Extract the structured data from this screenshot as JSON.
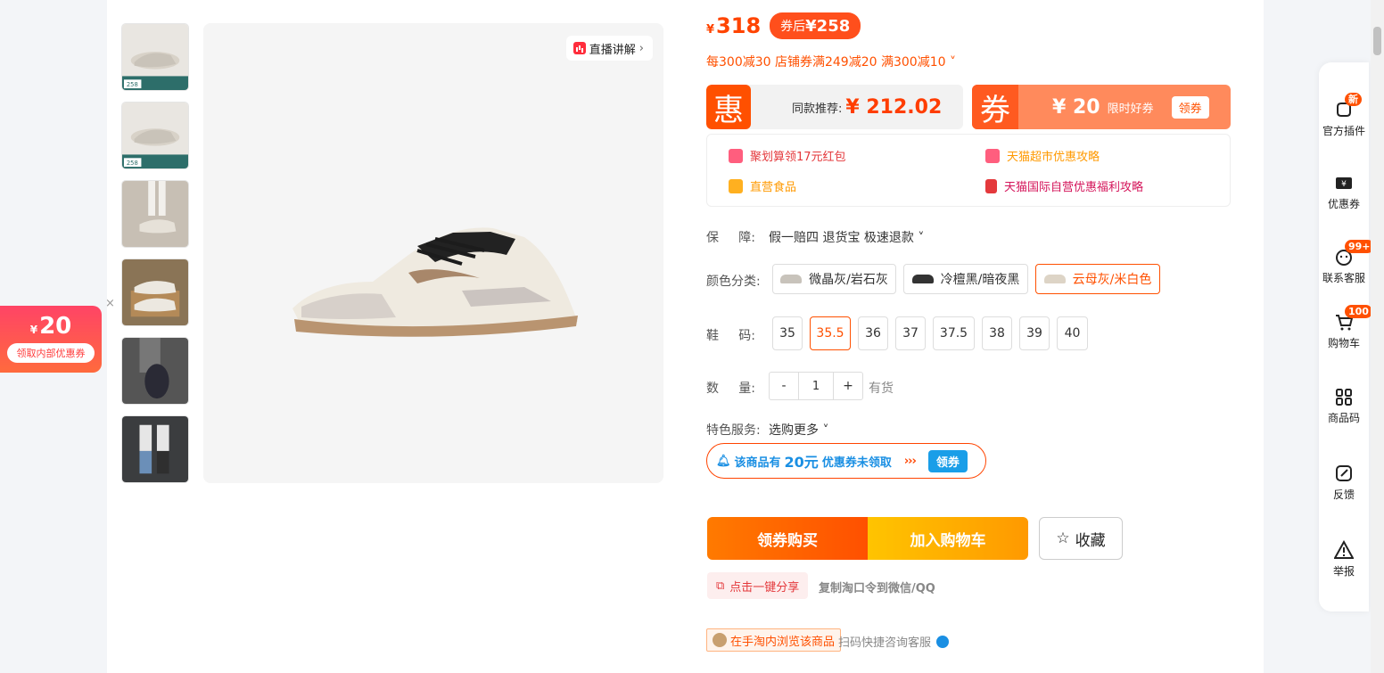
{
  "product": {
    "live_label": "直播讲解",
    "price_symbol": "¥",
    "price": "318",
    "coupon_price_prefix": "券后",
    "coupon_price": "¥258",
    "promotions": "每300减30 店铺券满249减20 满300减10"
  },
  "deals": {
    "hui_tag": "惠",
    "hui_text": "同款推荐:",
    "hui_price": "¥ 212.02",
    "quan_tag": "券",
    "quan_amount": "¥ 20",
    "quan_text": "限时好券",
    "quan_button": "领券"
  },
  "links": [
    {
      "label": "聚划算领17元红包",
      "color": "#e4393c"
    },
    {
      "label": "天猫超市优惠攻略",
      "color": "#ff9900"
    },
    {
      "label": "直营食品",
      "color": "#ff9900"
    },
    {
      "label": "天猫国际自营优惠福利攻略",
      "color": "#d4145a"
    }
  ],
  "guarantee": {
    "label": "保     障:",
    "value": "假一赔四 退货宝 极速退款"
  },
  "colors": {
    "label": "颜色分类:",
    "options": [
      "微晶灰/岩石灰",
      "冷檀黑/暗夜黑",
      "云母灰/米白色"
    ],
    "selected": 2
  },
  "sizes": {
    "label": "鞋     码:",
    "options": [
      "35",
      "35.5",
      "36",
      "37",
      "37.5",
      "38",
      "39",
      "40"
    ],
    "selected": 1
  },
  "quantity": {
    "label": "数     量:",
    "minus": "-",
    "value": "1",
    "plus": "+",
    "stock": "有货"
  },
  "services": {
    "label": "特色服务:",
    "value": "选购更多"
  },
  "ticket": {
    "prefix": "该商品有",
    "amount": "20元",
    "suffix": "优惠券未领取",
    "arrows": "›››",
    "button": "领券"
  },
  "actions": {
    "buy": "领券购买",
    "cart": "加入购物车",
    "favorite": "收藏",
    "share": "点击一键分享",
    "share_tip": "复制淘口令到微信/QQ",
    "taobao": "在手淘内浏览该商品",
    "scan": "扫码快捷咨询客服"
  },
  "float_coupon": {
    "symbol": "¥",
    "amount": "20",
    "button": "领取内部优惠券",
    "close": "×"
  },
  "sidebar": [
    {
      "label": "官方插件",
      "badge": "新",
      "icon": "plugin-icon"
    },
    {
      "label": "优惠券",
      "badge": "",
      "icon": "coupon-icon"
    },
    {
      "label": "联系客服",
      "badge": "99+",
      "icon": "service-icon"
    },
    {
      "label": "购物车",
      "badge": "100",
      "icon": "cart-icon"
    },
    {
      "label": "商品码",
      "badge": "",
      "icon": "qrcode-icon"
    },
    {
      "label": "反馈",
      "badge": "",
      "icon": "feedback-icon"
    },
    {
      "label": "举报",
      "badge": "",
      "icon": "report-icon"
    }
  ],
  "thumb_badges": [
    "258",
    "258"
  ],
  "accent_colors": {
    "primary": "#ff5000",
    "blue": "#1a8fe3"
  }
}
